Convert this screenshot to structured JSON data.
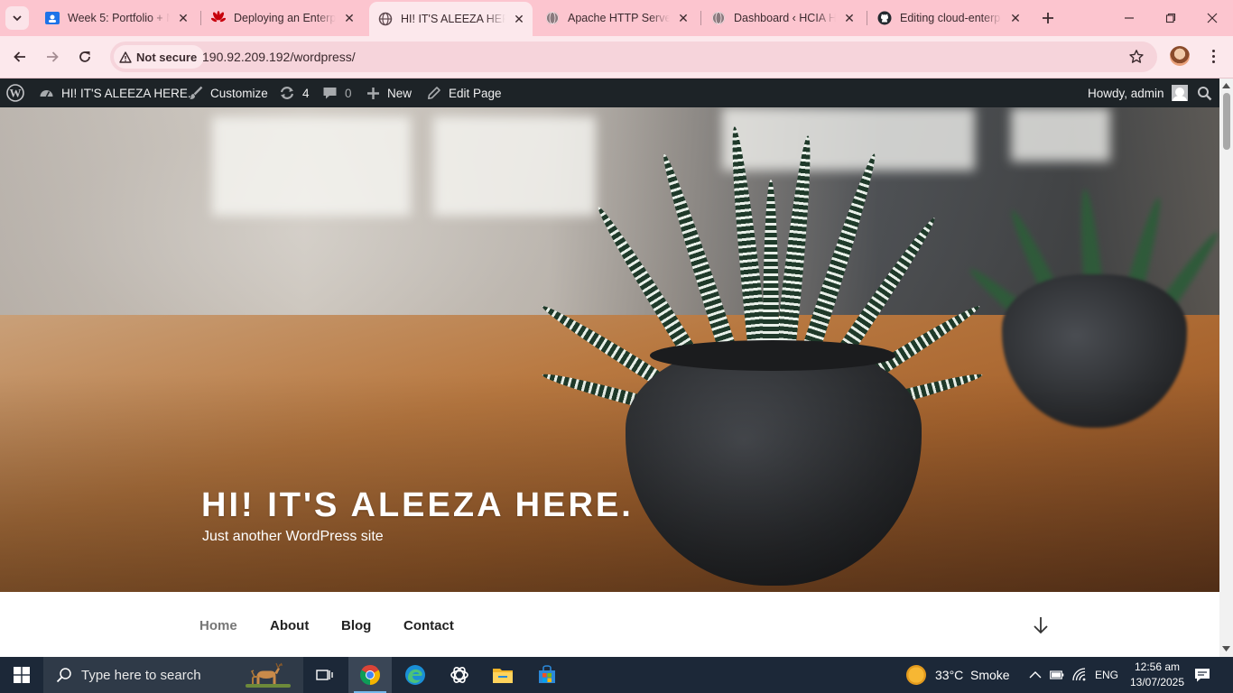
{
  "browser": {
    "tabs": [
      {
        "title": "Week 5: Portfolio + M",
        "favicon": "google-classroom-icon",
        "active": false
      },
      {
        "title": "Deploying an Enterpr",
        "favicon": "huawei-icon",
        "active": false
      },
      {
        "title": "HI! IT'S ALEEZA HERE",
        "favicon": "globe-icon",
        "active": true
      },
      {
        "title": "Apache HTTP Server",
        "favicon": "globe-icon",
        "active": false
      },
      {
        "title": "Dashboard ‹ HCIA HE",
        "favicon": "globe-icon",
        "active": false
      },
      {
        "title": "Editing cloud-enterp",
        "favicon": "github-icon",
        "active": false
      }
    ],
    "security_label": "Not secure",
    "url": "190.92.209.192/wordpress/",
    "colors": {
      "tabstrip": "#fcc5cf",
      "toolbar": "#fce8ec",
      "omnibox": "#f6d4db"
    }
  },
  "adminbar": {
    "site_name": "HI! IT'S ALEEZA HERE.",
    "customize": "Customize",
    "updates_count": "4",
    "comments_count": "0",
    "new_label": "New",
    "edit_label": "Edit Page",
    "greeting": "Howdy, admin"
  },
  "site": {
    "title": "HI! IT'S ALEEZA HERE.",
    "tagline": "Just another WordPress site",
    "nav": [
      "Home",
      "About",
      "Blog",
      "Contact"
    ],
    "current_nav": "Home"
  },
  "taskbar": {
    "search_placeholder": "Type here to search",
    "apps": [
      "task-view-icon",
      "chrome-icon",
      "edge-icon",
      "chatgpt-icon",
      "file-explorer-icon",
      "microsoft-store-icon"
    ],
    "weather_temp": "33°C",
    "weather_desc": "Smoke",
    "language": "ENG",
    "time": "12:56 am",
    "date": "13/07/2025"
  }
}
